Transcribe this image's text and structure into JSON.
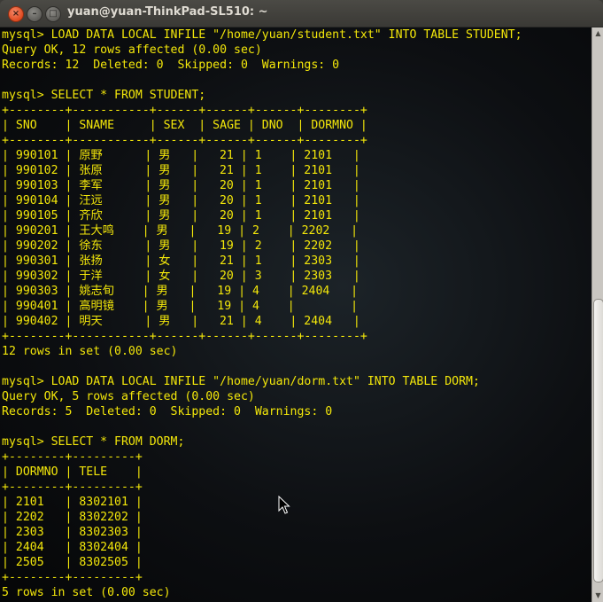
{
  "window": {
    "title": "yuan@yuan-ThinkPad-SL510: ~",
    "close_glyph": "×",
    "minimize_glyph": "–",
    "maximize_glyph": "□"
  },
  "scrollbar": {
    "up_arrow": "▲",
    "down_arrow": "▼"
  },
  "terminal": {
    "text_color": "#f3e70a",
    "lines": [
      "mysql> LOAD DATA LOCAL INFILE \"/home/yuan/student.txt\" INTO TABLE STUDENT;",
      "Query OK, 12 rows affected (0.00 sec)",
      "Records: 12  Deleted: 0  Skipped: 0  Warnings: 0",
      "",
      "mysql> SELECT * FROM STUDENT;",
      "+--------+-----------+------+------+------+--------+",
      "| SNO    | SNAME     | SEX  | SAGE | DNO  | DORMNO |",
      "+--------+-----------+------+------+------+--------+",
      "| 990101 | 原野      | 男   |   21 | 1    | 2101   |",
      "| 990102 | 张原      | 男   |   21 | 1    | 2101   |",
      "| 990103 | 李军      | 男   |   20 | 1    | 2101   |",
      "| 990104 | 汪远      | 男   |   20 | 1    | 2101   |",
      "| 990105 | 齐欣      | 男   |   20 | 1    | 2101   |",
      "| 990201 | 王大鸣    | 男   |   19 | 2    | 2202   |",
      "| 990202 | 徐东      | 男   |   19 | 2    | 2202   |",
      "| 990301 | 张扬      | 女   |   21 | 1    | 2303   |",
      "| 990302 | 于洋      | 女   |   20 | 3    | 2303   |",
      "| 990303 | 姚志旬    | 男   |   19 | 4    | 2404   |",
      "| 990401 | 高明镜    | 男   |   19 | 4    |        |",
      "| 990402 | 明天      | 男   |   21 | 4    | 2404   |",
      "+--------+-----------+------+------+------+--------+",
      "12 rows in set (0.00 sec)",
      "",
      "mysql> LOAD DATA LOCAL INFILE \"/home/yuan/dorm.txt\" INTO TABLE DORM;",
      "Query OK, 5 rows affected (0.00 sec)",
      "Records: 5  Deleted: 0  Skipped: 0  Warnings: 0",
      "",
      "mysql> SELECT * FROM DORM;",
      "+--------+---------+",
      "| DORMNO | TELE    |",
      "+--------+---------+",
      "| 2101   | 8302101 |",
      "| 2202   | 8302202 |",
      "| 2303   | 8302303 |",
      "| 2404   | 8302404 |",
      "| 2505   | 8302505 |",
      "+--------+---------+",
      "5 rows in set (0.00 sec)"
    ]
  }
}
